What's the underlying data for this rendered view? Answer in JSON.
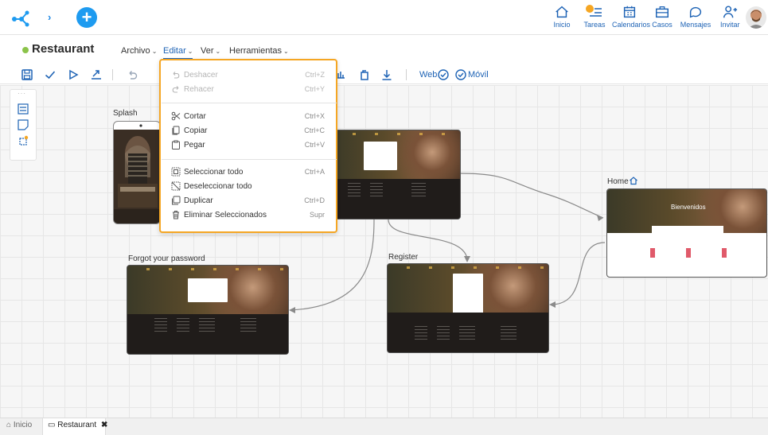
{
  "topbar": {
    "nav": [
      {
        "label": "Inicio",
        "icon": "home-icon"
      },
      {
        "label": "Tareas",
        "icon": "tasks-icon",
        "badge": ""
      },
      {
        "label": "Calendarios",
        "icon": "calendar-icon"
      },
      {
        "label": "Casos",
        "icon": "briefcase-icon"
      },
      {
        "label": "Mensajes",
        "icon": "chat-icon"
      },
      {
        "label": "Invitar",
        "icon": "invite-icon"
      }
    ],
    "badge_color": "#f5a623",
    "accent_color": "#1e63b5"
  },
  "app": {
    "title": "Restaurant",
    "status_color": "#8bc34a"
  },
  "menubar": {
    "items": [
      {
        "label": "Archivo"
      },
      {
        "label": "Editar"
      },
      {
        "label": "Ver"
      },
      {
        "label": "Herramientas"
      }
    ]
  },
  "toolbar": {
    "web_label": "Web",
    "movil_label": "Móvil"
  },
  "dropdown": {
    "border_color": "#f5a623",
    "groups": [
      [
        {
          "label": "Deshacer",
          "shortcut": "Ctrl+Z",
          "icon": "undo-icon",
          "disabled": true
        },
        {
          "label": "Rehacer",
          "shortcut": "Ctrl+Y",
          "icon": "redo-icon",
          "disabled": true
        }
      ],
      [
        {
          "label": "Cortar",
          "shortcut": "Ctrl+X",
          "icon": "scissors-icon",
          "disabled": false
        },
        {
          "label": "Copiar",
          "shortcut": "Ctrl+C",
          "icon": "copy-icon",
          "disabled": false
        },
        {
          "label": "Pegar",
          "shortcut": "Ctrl+V",
          "icon": "paste-icon",
          "disabled": false
        }
      ],
      [
        {
          "label": "Seleccionar todo",
          "shortcut": "Ctrl+A",
          "icon": "select-all-icon",
          "disabled": false
        },
        {
          "label": "Deseleccionar todo",
          "shortcut": "",
          "icon": "deselect-all-icon",
          "disabled": false
        },
        {
          "label": "Duplicar",
          "shortcut": "Ctrl+D",
          "icon": "duplicate-icon",
          "disabled": false
        },
        {
          "label": "Eliminar Seleccionados",
          "shortcut": "Supr",
          "icon": "trash-icon",
          "disabled": false
        }
      ]
    ]
  },
  "canvas": {
    "nodes": [
      {
        "label": "Splash"
      },
      {
        "label": "Home"
      },
      {
        "label": "Forgot your password"
      },
      {
        "label": "Register"
      }
    ],
    "home_hero_text": "Bienvenidos"
  },
  "bottom_tabs": [
    {
      "label": "Inicio"
    },
    {
      "label": "Restaurant"
    }
  ]
}
